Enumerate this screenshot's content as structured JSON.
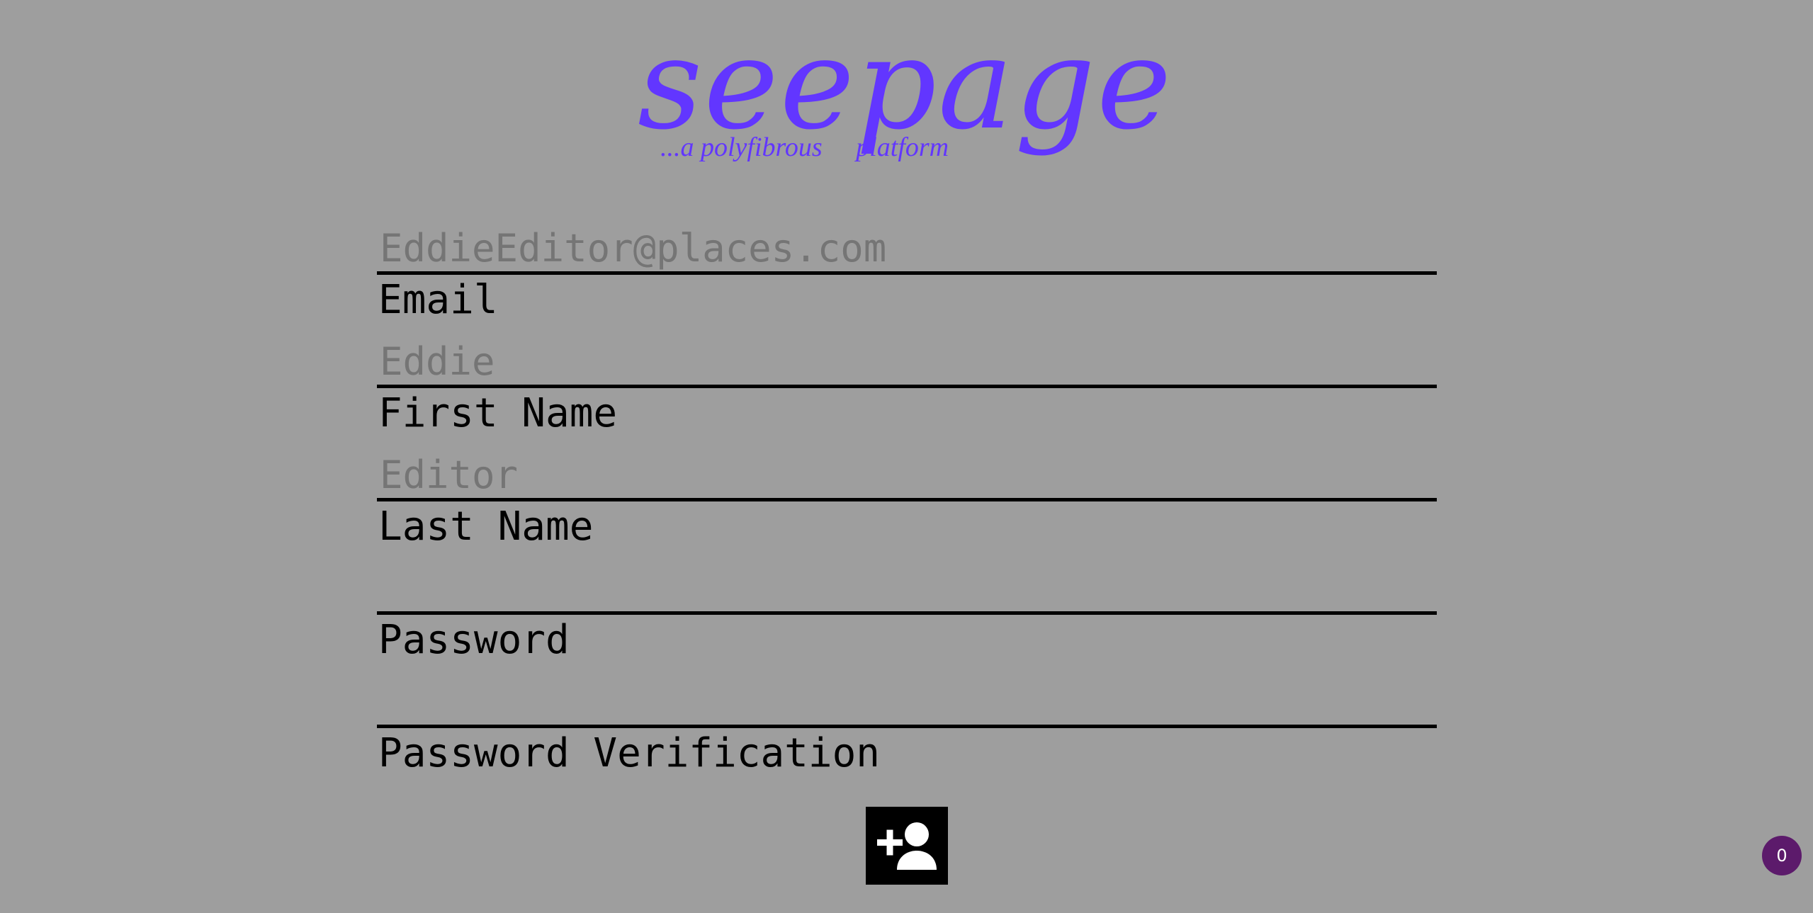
{
  "brand": {
    "name": "seepage",
    "tagline": "...a polyfibrous     platform",
    "color": "#6236ff"
  },
  "form": {
    "fields": [
      {
        "label": "Email",
        "placeholder": "EddieEditor@places.com",
        "value": ""
      },
      {
        "label": "First Name",
        "placeholder": "Eddie",
        "value": ""
      },
      {
        "label": "Last Name",
        "placeholder": "Editor",
        "value": ""
      },
      {
        "label": "Password",
        "placeholder": "",
        "value": ""
      },
      {
        "label": "Password Verification",
        "placeholder": "",
        "value": ""
      }
    ],
    "submit": {
      "icon": "add-user-icon"
    }
  },
  "badge": {
    "count": "0",
    "color": "#5c1a6b"
  },
  "colors": {
    "background": "#9e9e9e",
    "text": "#000000",
    "placeholder": "#757575"
  }
}
